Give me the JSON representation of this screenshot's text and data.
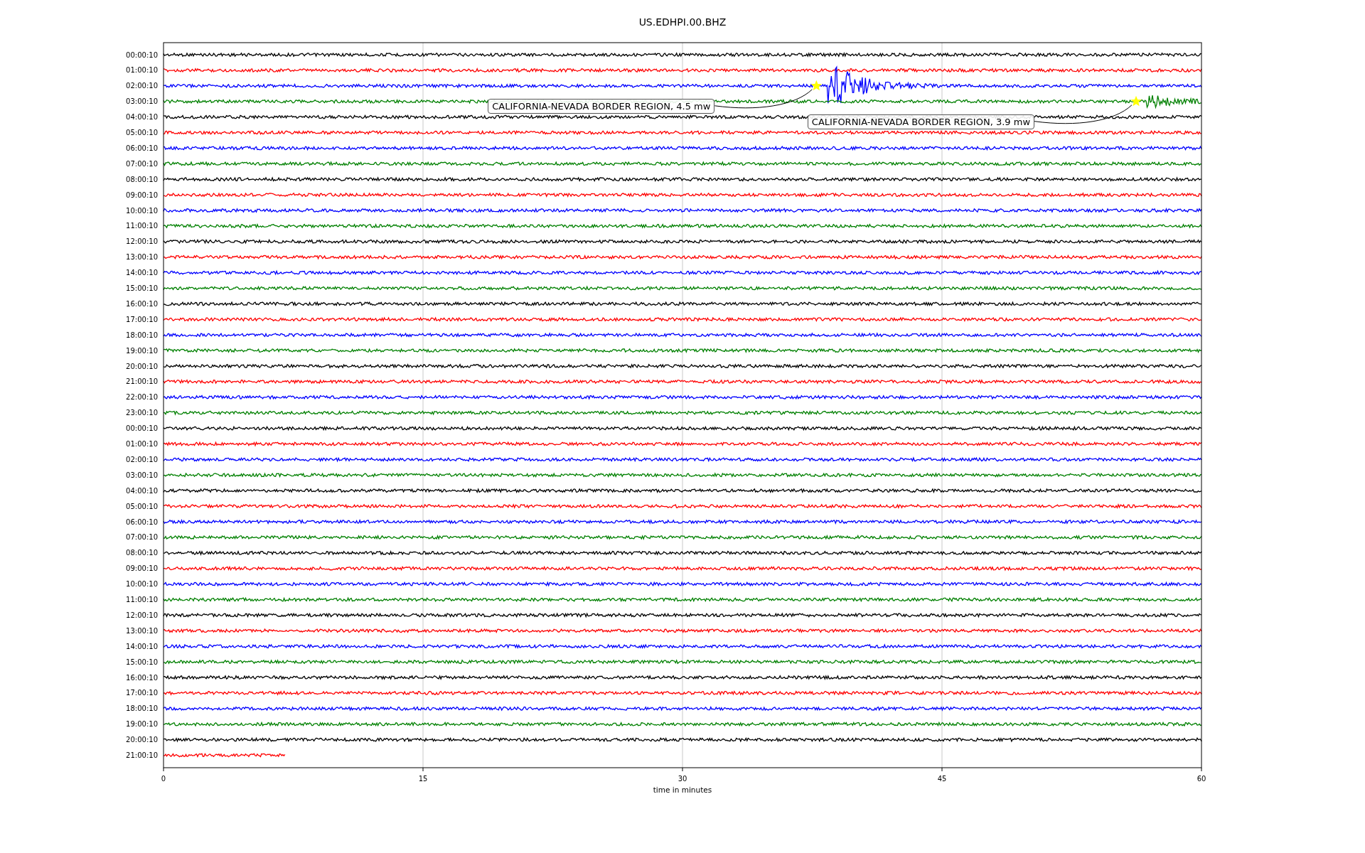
{
  "title": "US.EDHPI.00.BHZ",
  "xlabel": "time in minutes",
  "xticks": [
    "0",
    "15",
    "30",
    "45",
    "60"
  ],
  "rows": [
    {
      "label": "00:00:10",
      "color": "#000000"
    },
    {
      "label": "01:00:10",
      "color": "#ff0000"
    },
    {
      "label": "02:00:10",
      "color": "#0000ff",
      "event": {
        "label": "CALIFORNIA-NEVADA BORDER REGION, 4.5 mw"
      }
    },
    {
      "label": "03:00:10",
      "color": "#008000",
      "event": {
        "label": "CALIFORNIA-NEVADA BORDER REGION, 3.9 mw"
      }
    },
    {
      "label": "04:00:10",
      "color": "#000000"
    },
    {
      "label": "05:00:10",
      "color": "#ff0000"
    },
    {
      "label": "06:00:10",
      "color": "#0000ff"
    },
    {
      "label": "07:00:10",
      "color": "#008000"
    },
    {
      "label": "08:00:10",
      "color": "#000000"
    },
    {
      "label": "09:00:10",
      "color": "#ff0000"
    },
    {
      "label": "10:00:10",
      "color": "#0000ff"
    },
    {
      "label": "11:00:10",
      "color": "#008000"
    },
    {
      "label": "12:00:10",
      "color": "#000000"
    },
    {
      "label": "13:00:10",
      "color": "#ff0000"
    },
    {
      "label": "14:00:10",
      "color": "#0000ff"
    },
    {
      "label": "15:00:10",
      "color": "#008000"
    },
    {
      "label": "16:00:10",
      "color": "#000000"
    },
    {
      "label": "17:00:10",
      "color": "#ff0000"
    },
    {
      "label": "18:00:10",
      "color": "#0000ff"
    },
    {
      "label": "19:00:10",
      "color": "#008000"
    },
    {
      "label": "20:00:10",
      "color": "#000000"
    },
    {
      "label": "21:00:10",
      "color": "#ff0000"
    },
    {
      "label": "22:00:10",
      "color": "#0000ff"
    },
    {
      "label": "23:00:10",
      "color": "#008000"
    },
    {
      "label": "00:00:10",
      "color": "#000000"
    },
    {
      "label": "01:00:10",
      "color": "#ff0000"
    },
    {
      "label": "02:00:10",
      "color": "#0000ff"
    },
    {
      "label": "03:00:10",
      "color": "#008000"
    },
    {
      "label": "04:00:10",
      "color": "#000000"
    },
    {
      "label": "05:00:10",
      "color": "#ff0000"
    },
    {
      "label": "06:00:10",
      "color": "#0000ff"
    },
    {
      "label": "07:00:10",
      "color": "#008000"
    },
    {
      "label": "08:00:10",
      "color": "#000000"
    },
    {
      "label": "09:00:10",
      "color": "#ff0000"
    },
    {
      "label": "10:00:10",
      "color": "#0000ff"
    },
    {
      "label": "11:00:10",
      "color": "#008000"
    },
    {
      "label": "12:00:10",
      "color": "#000000"
    },
    {
      "label": "13:00:10",
      "color": "#ff0000"
    },
    {
      "label": "14:00:10",
      "color": "#0000ff"
    },
    {
      "label": "15:00:10",
      "color": "#008000"
    },
    {
      "label": "16:00:10",
      "color": "#000000"
    },
    {
      "label": "17:00:10",
      "color": "#ff0000"
    },
    {
      "label": "18:00:10",
      "color": "#0000ff"
    },
    {
      "label": "19:00:10",
      "color": "#008000"
    },
    {
      "label": "20:00:10",
      "color": "#000000"
    },
    {
      "label": "21:00:10",
      "color": "#ff0000"
    }
  ]
}
